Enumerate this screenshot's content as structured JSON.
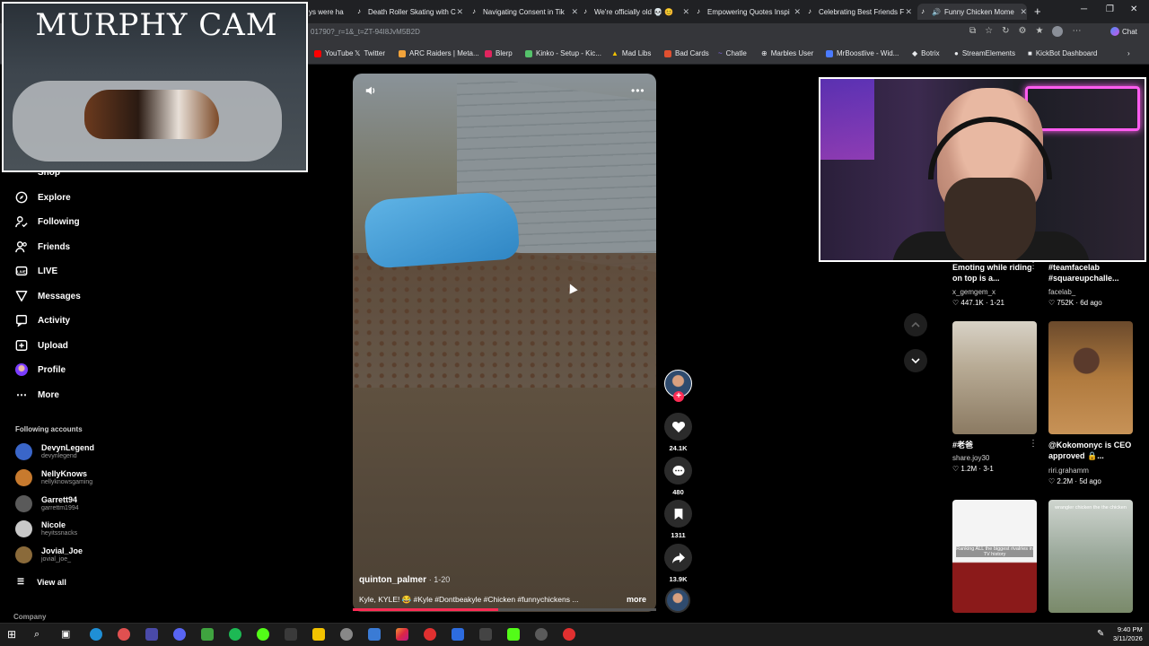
{
  "browser": {
    "tabs": [
      {
        "label": "ys were ha"
      },
      {
        "label": "Death Roller Skating with C"
      },
      {
        "label": "Navigating Consent in Tik"
      },
      {
        "label": "We're officially old 💀 😊"
      },
      {
        "label": "Empowering Quotes Inspi"
      },
      {
        "label": "Celebrating Best Friends F"
      },
      {
        "label": "Funny Chicken Mome"
      }
    ],
    "url": "01790?_r=1&_t=ZT-94I8JvM5B2D",
    "chat_label": "Chat",
    "bookmarks": [
      {
        "label": "YouTube",
        "color": "#ff0000"
      },
      {
        "label": "Twitter",
        "color": "#ffffff"
      },
      {
        "label": "ARC Raiders | Meta...",
        "color": "#f2a33a"
      },
      {
        "label": "Blerp",
        "color": "#e0245e"
      },
      {
        "label": "Kinko - Setup - Kic...",
        "color": "#55c26b"
      },
      {
        "label": "Mad Libs",
        "color": "#f2c200"
      },
      {
        "label": "Bad Cards",
        "color": "#e05030"
      },
      {
        "label": "Chatle",
        "color": "#8a6cff"
      },
      {
        "label": "Marbles User",
        "color": "#bbbbbb"
      },
      {
        "label": "MrBoostlive - Wid...",
        "color": "#4b7bff"
      },
      {
        "label": "Botrix",
        "color": "#ffffff"
      },
      {
        "label": "StreamElements",
        "color": "#ffffff"
      },
      {
        "label": "KickBot Dashboard",
        "color": "#ffffff"
      }
    ]
  },
  "overlay": {
    "cam_title": "MURPHY CAM"
  },
  "sidebar": {
    "partial_item": "Shop",
    "items": [
      {
        "label": "Explore",
        "icon": "compass-icon"
      },
      {
        "label": "Following",
        "icon": "user-check-icon"
      },
      {
        "label": "Friends",
        "icon": "friends-icon"
      },
      {
        "label": "LIVE",
        "icon": "live-icon"
      },
      {
        "label": "Messages",
        "icon": "send-icon"
      },
      {
        "label": "Activity",
        "icon": "activity-icon"
      },
      {
        "label": "Upload",
        "icon": "upload-icon"
      },
      {
        "label": "Profile",
        "icon": "profile-avatar"
      },
      {
        "label": "More",
        "icon": "more-icon"
      }
    ],
    "following_heading": "Following accounts",
    "accounts": [
      {
        "name": "DevynLegend",
        "handle": "devynlegend",
        "color": "#3a66c9"
      },
      {
        "name": "NellyKnows",
        "handle": "nellyknowsgaming",
        "color": "#c77a2e"
      },
      {
        "name": "Garrett94",
        "handle": "garrettm1994",
        "color": "#5a5a5a"
      },
      {
        "name": "Nicole",
        "handle": "heyitssnacks",
        "color": "#c9c9c9"
      },
      {
        "name": "Jovial_Joe",
        "handle": "jovial_joe_",
        "color": "#8a6a3a"
      }
    ],
    "view_all": "View all",
    "company": "Company"
  },
  "video": {
    "author": "quinton_palmer",
    "date": "1-20",
    "caption": "Kyle, KYLE! 😂 #Kyle #Dontbeakyle #Chicken #funnychickens ...",
    "more_label": "more",
    "progress": 0.48,
    "likes": "24.1K",
    "comments": "480",
    "saves": "1311",
    "shares": "13.9K"
  },
  "grid": {
    "cards": [
      {
        "title": "Emoting while riding on top is a...",
        "user": "x_gemgem_x",
        "likes": "447.1K",
        "date": "1-21"
      },
      {
        "title": "#teamfacelab #squareupchalle...",
        "user": "facelab_",
        "likes": "752K",
        "date": "6d ago"
      },
      {
        "title": "#老爸",
        "user": "share.joy30",
        "likes": "1.2M",
        "date": "3-1"
      },
      {
        "title": "@Kokomonyc is CEO approved 🔒...",
        "user": "riri.grahamm",
        "likes": "2.2M",
        "date": "5d ago"
      }
    ],
    "thumb3_text": "Ranking ALL the biggest rivalries in TV history",
    "thumb4_text": "wrangler chicken the the chicken"
  },
  "taskbar": {
    "time": "9:40 PM",
    "date": "3/11/2026"
  }
}
